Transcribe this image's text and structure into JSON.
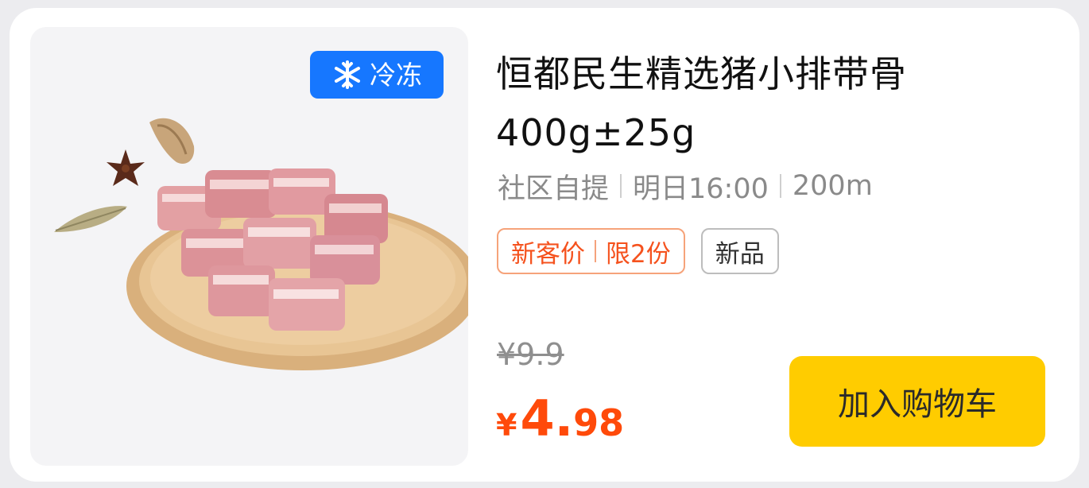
{
  "product": {
    "badge": "冷冻",
    "badge_icon": "snowflake-icon",
    "image_icon": "pork-ribs-on-wooden-plate",
    "title_line1": "恒都民生精选猪小排带骨",
    "title_line2": "400g±25g",
    "meta": {
      "delivery": "社区自提",
      "time": "明日16:00",
      "distance": "200m"
    },
    "tags": {
      "offer_label": "新客价",
      "offer_limit": "限2份",
      "new_label": "新品"
    },
    "original_price": "¥9.9",
    "price": {
      "currency": "¥",
      "integer": "4.",
      "decimal": "98"
    },
    "add_to_cart_label": "加入购物车"
  },
  "colors": {
    "badge_blue": "#1677ff",
    "price_orange": "#ff4a0a",
    "cart_yellow": "#ffcc00"
  }
}
